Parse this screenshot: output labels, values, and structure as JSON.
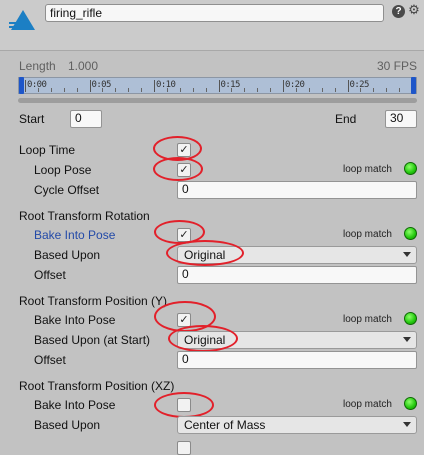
{
  "header": {
    "clip_name": "firing_rifle",
    "help": "?",
    "settings": "⚙"
  },
  "timeline": {
    "length_label": "Length",
    "length_value": "1.000",
    "fps": "30 FPS",
    "ticks": [
      "0:00",
      "0:05",
      "0:10",
      "0:15",
      "0:20",
      "0:25"
    ]
  },
  "range": {
    "start_label": "Start",
    "start_value": "0",
    "end_label": "End",
    "end_value": "30"
  },
  "loop_time": {
    "label": "Loop Time",
    "checked": true,
    "loop_pose_label": "Loop Pose",
    "loop_pose_checked": true,
    "loop_match": "loop match",
    "cycle_offset_label": "Cycle Offset",
    "cycle_offset_value": "0"
  },
  "rotation": {
    "label": "Root Transform Rotation",
    "bake_label": "Bake Into Pose",
    "bake_checked": true,
    "loop_match": "loop match",
    "based_upon_label": "Based Upon",
    "based_upon_value": "Original",
    "offset_label": "Offset",
    "offset_value": "0"
  },
  "position_y": {
    "label": "Root Transform Position (Y)",
    "bake_label": "Bake Into Pose",
    "bake_checked": true,
    "loop_match": "loop match",
    "based_upon_label": "Based Upon (at Start)",
    "based_upon_value": "Original",
    "offset_label": "Offset",
    "offset_value": "0"
  },
  "position_xz": {
    "label": "Root Transform Position (XZ)",
    "bake_label": "Bake Into Pose",
    "bake_checked": false,
    "loop_match": "loop match",
    "based_upon_label": "Based Upon",
    "based_upon_value": "Center of Mass"
  },
  "colors": {
    "annotation": "#e2202a",
    "match_indicator": "#22c80d",
    "timeline_fill": "#aebfd6",
    "range_marker": "#1e56c9"
  },
  "check_glyph": "✓"
}
